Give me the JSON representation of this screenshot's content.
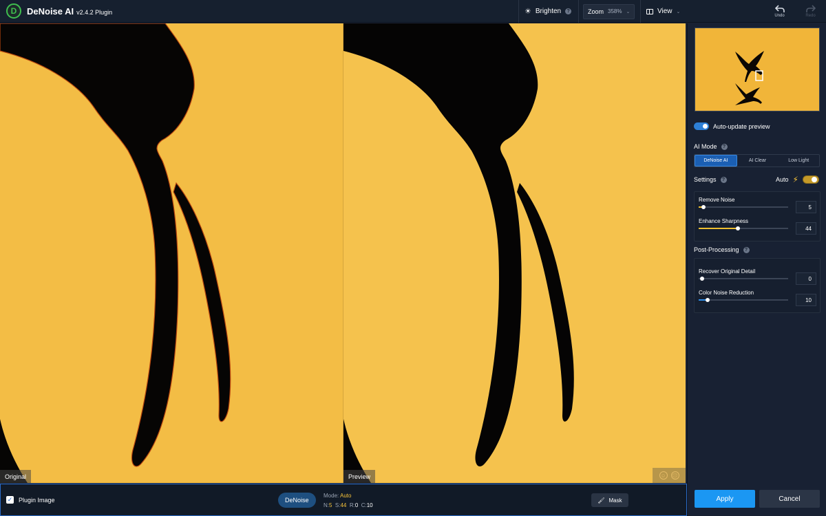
{
  "app": {
    "name": "DeNoise AI",
    "version": "v2.4.2 Plugin",
    "logo_letter": "D"
  },
  "toolbar": {
    "brighten_label": "Brighten",
    "zoom_label": "Zoom",
    "zoom_value": "358%",
    "view_label": "View",
    "undo_label": "Undo",
    "redo_label": "Redo"
  },
  "canvas": {
    "left_label": "Original",
    "right_label": "Preview"
  },
  "bottom": {
    "plugin_image_label": "Plugin Image",
    "plugin_image_checked": true,
    "model_pill": "DeNoise",
    "mode_label": "Mode:",
    "mode_value": "Auto",
    "n_label": "N:",
    "n_value": "5",
    "s_label": "S:",
    "s_value": "44",
    "r_label": "R:",
    "r_value": "0",
    "c_label": "C:",
    "c_value": "10",
    "mask_label": "Mask"
  },
  "panel": {
    "auto_update_label": "Auto-update preview",
    "auto_update_on": true,
    "ai_mode_title": "AI Mode",
    "ai_modes": [
      "DeNoise AI",
      "AI Clear",
      "Low Light"
    ],
    "ai_mode_active": "DeNoise AI",
    "settings_title": "Settings",
    "auto_label": "Auto",
    "settings_sliders": [
      {
        "label": "Remove Noise",
        "value": "5",
        "fraction": 0.05
      },
      {
        "label": "Enhance Sharpness",
        "value": "44",
        "fraction": 0.44
      }
    ],
    "post_title": "Post-Processing",
    "post_sliders": [
      {
        "label": "Recover Original Detail",
        "value": "0",
        "fraction": 0.0
      },
      {
        "label": "Color Noise Reduction",
        "value": "10",
        "fraction": 0.1
      }
    ],
    "apply_label": "Apply",
    "cancel_label": "Cancel"
  },
  "colors": {
    "accent": "#1b97f3",
    "sky": "#f4bf48",
    "silhouette": "#060504",
    "highlight": "#f5c23a",
    "slider_yellow": "#f0c030",
    "slider_blue": "#2d8de8"
  }
}
